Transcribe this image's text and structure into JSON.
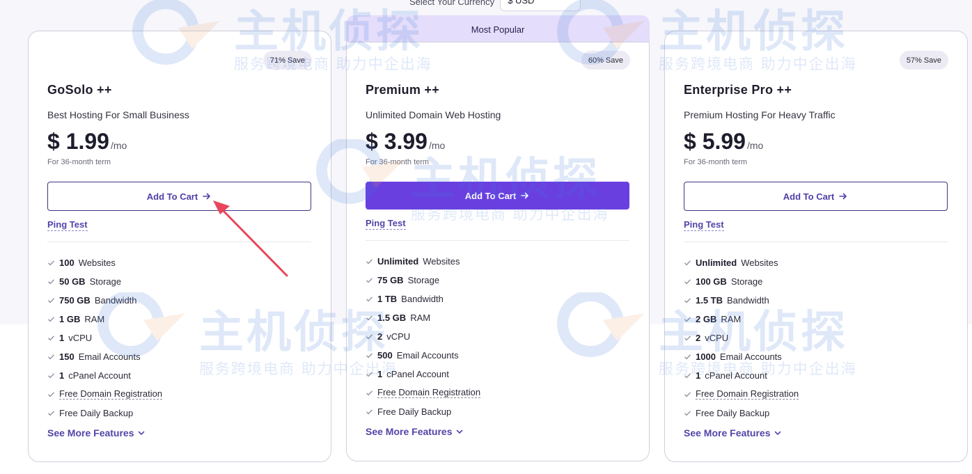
{
  "currency": {
    "label": "Select Your Currency",
    "value": "$ USD"
  },
  "popular_label": "Most Popular",
  "plans": [
    {
      "name": "GoSolo ++",
      "subtitle": "Best Hosting For Small Business",
      "save": "71% Save",
      "price": "$ 1.99",
      "per": "/mo",
      "term": "For 36-month term",
      "cart_label": "Add To Cart",
      "ping_label": "Ping Test",
      "features": [
        {
          "value": "100",
          "text": "Websites"
        },
        {
          "value": "50 GB",
          "text": "Storage"
        },
        {
          "value": "750 GB",
          "text": "Bandwidth"
        },
        {
          "value": "1 GB",
          "text": "RAM"
        },
        {
          "value": "1",
          "text": "vCPU"
        },
        {
          "value": "150",
          "text": "Email Accounts"
        },
        {
          "value": "1",
          "text": "cPanel Account"
        },
        {
          "value": "",
          "text": "Free Domain Registration"
        },
        {
          "value": "",
          "text": "Free Daily Backup"
        }
      ],
      "see_more": "See More Features"
    },
    {
      "name": "Premium ++",
      "subtitle": "Unlimited Domain Web Hosting",
      "save": "60% Save",
      "price": "$ 3.99",
      "per": "/mo",
      "term": "For 36-month term",
      "cart_label": "Add To Cart",
      "ping_label": "Ping Test",
      "features": [
        {
          "value": "Unlimited",
          "text": "Websites"
        },
        {
          "value": "75 GB",
          "text": "Storage"
        },
        {
          "value": "1 TB",
          "text": "Bandwidth"
        },
        {
          "value": "1.5 GB",
          "text": "RAM"
        },
        {
          "value": "2",
          "text": "vCPU"
        },
        {
          "value": "500",
          "text": "Email Accounts"
        },
        {
          "value": "1",
          "text": "cPanel Account"
        },
        {
          "value": "",
          "text": "Free Domain Registration"
        },
        {
          "value": "",
          "text": "Free Daily Backup"
        }
      ],
      "see_more": "See More Features"
    },
    {
      "name": "Enterprise Pro ++",
      "subtitle": "Premium Hosting For Heavy Traffic",
      "save": "57% Save",
      "price": "$ 5.99",
      "per": "/mo",
      "term": "For 36-month term",
      "cart_label": "Add To Cart",
      "ping_label": "Ping Test",
      "features": [
        {
          "value": "Unlimited",
          "text": "Websites"
        },
        {
          "value": "100 GB",
          "text": "Storage"
        },
        {
          "value": "1.5 TB",
          "text": "Bandwidth"
        },
        {
          "value": "2 GB",
          "text": "RAM"
        },
        {
          "value": "2",
          "text": "vCPU"
        },
        {
          "value": "1000",
          "text": "Email Accounts"
        },
        {
          "value": "1",
          "text": "cPanel Account"
        },
        {
          "value": "",
          "text": "Free Domain Registration"
        },
        {
          "value": "",
          "text": "Free Daily Backup"
        }
      ],
      "see_more": "See More Features"
    }
  ],
  "watermark": {
    "main": "主机侦探",
    "sub": "服务跨境电商 助力中企出海"
  },
  "colors": {
    "accent": "#6a3fe0",
    "link": "#5145a8",
    "annotation_arrow": "#e8465a"
  },
  "icons": {
    "check": "check-icon",
    "arrow": "arrow-right-icon",
    "chevron": "chevron-down-icon"
  }
}
